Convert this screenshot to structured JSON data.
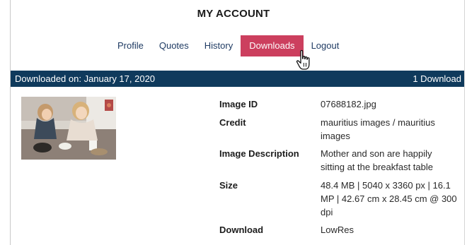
{
  "account": {
    "title": "MY ACCOUNT"
  },
  "tabs": [
    {
      "label": "Profile",
      "active": false
    },
    {
      "label": "Quotes",
      "active": false
    },
    {
      "label": "History",
      "active": false
    },
    {
      "label": "Downloads",
      "active": true
    },
    {
      "label": "Logout",
      "active": false
    }
  ],
  "download_bar": {
    "date_text": "Downloaded on: January 17, 2020",
    "count_text": "1 Download"
  },
  "image_details": {
    "image_id_label": "Image ID",
    "image_id_value": "07688182.jpg",
    "credit_label": "Credit",
    "credit_value": "mauritius images / mauritius images",
    "description_label": "Image Description",
    "description_value": "Mother and son are happily sitting at the breakfast table",
    "size_label": "Size",
    "size_value": "48.4 MB | 5040 x 3360 px | 16.1 MP | 42.67 cm x 28.45 cm @ 300 dpi",
    "download_label": "Download",
    "download_value": "LowRes"
  },
  "colors": {
    "active_tab": "#cc3f5e",
    "tab_text": "#1f3b63",
    "bar_background": "#0f3a5c"
  },
  "icons": {
    "cursor": "hand-pointer-icon"
  }
}
